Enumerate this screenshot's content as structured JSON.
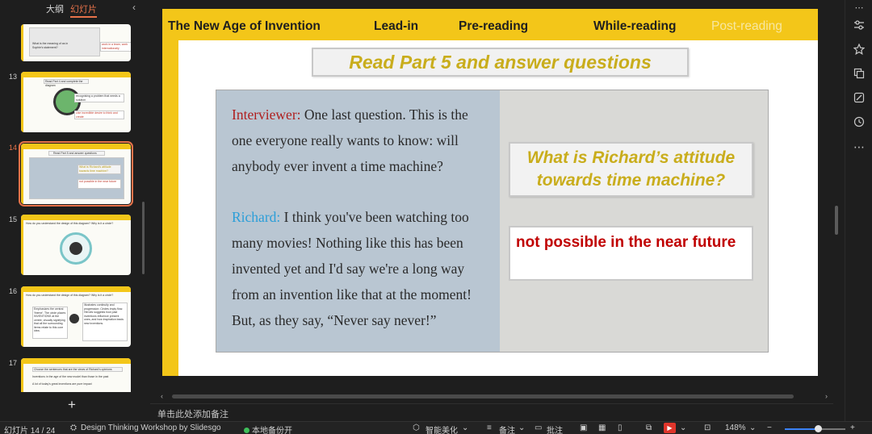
{
  "left_panel": {
    "tab_outline": "大纲",
    "tab_slides": "幻灯片",
    "collapse_glyph": "‹",
    "add_glyph": "+",
    "thumbs": [
      {
        "num": "",
        "text_a": "What is the meaning of as in Sophie's statement?",
        "text_b": "work in a team, work internationally"
      },
      {
        "num": "13",
        "title": "Read Part 4 and complete the diagram",
        "text_a": "recognising a problem that needs a solution",
        "text_b": "Use incredible desire to think and create"
      },
      {
        "num": "14",
        "title": "Read Part 5 and answer questions",
        "text_a": "What is Richard's attitude towards time machine?",
        "text_b": "not possible in the near future"
      },
      {
        "num": "15",
        "title": "How do you understand the design of this diagram? Why is it a circle?"
      },
      {
        "num": "16",
        "title": "How do you understand the design of this diagram? Why is it a circle?",
        "text_a": "Emphasizes the central 'theme'. The circle places INVENTIONS at the centre, visually signifying that all the surrounding items relate to this core idea.",
        "text_b": "Illustrates continuity and progression: Circles imply flow. Heroes suggests how past inventions influence present ones, and how inspiration leads new inventions."
      },
      {
        "num": "17",
        "title": "Choose the sentences that are the views of Richard's opinions",
        "text_a": "Inventions in the age of the new model than those in the past",
        "text_b": "A lot of today's great inventions are pure impact"
      }
    ]
  },
  "slide": {
    "nav": [
      "The New Age of Invention",
      "Lead-in",
      "Pre-reading",
      "While-reading",
      "Post-reading"
    ],
    "title": "Read Part 5 and answer questions",
    "interviewer_label": "Interviewer:",
    "interviewer_text": " One last question. This is the one everyone really wants to know: will anybody ever invent a time machine?",
    "richard_label": "Richard:",
    "richard_text": " I think you've been watching too many movies! Nothing like this has been invented yet and I'd say we're a long way from an invention like that at the moment! But, as they say, “Never say never!”",
    "question": "What is Richard’s attitude towards time machine?",
    "answer": "not possible in the near future"
  },
  "notes_placeholder": "单击此处添加备注",
  "status": {
    "slide_counter": "幻灯片 14 / 24",
    "theme": "Design Thinking Workshop by Slidesgo",
    "backup": "本地备份开",
    "beautify": "智能美化",
    "notes": "备注",
    "comments": "批注",
    "zoom": "148%",
    "zoom_fraction": 0.55
  },
  "right_toolbar_icons": [
    "more-top-icon",
    "adjust-icon",
    "star-icon",
    "layers-icon",
    "edit-image-icon",
    "history-icon",
    "more-icon"
  ]
}
